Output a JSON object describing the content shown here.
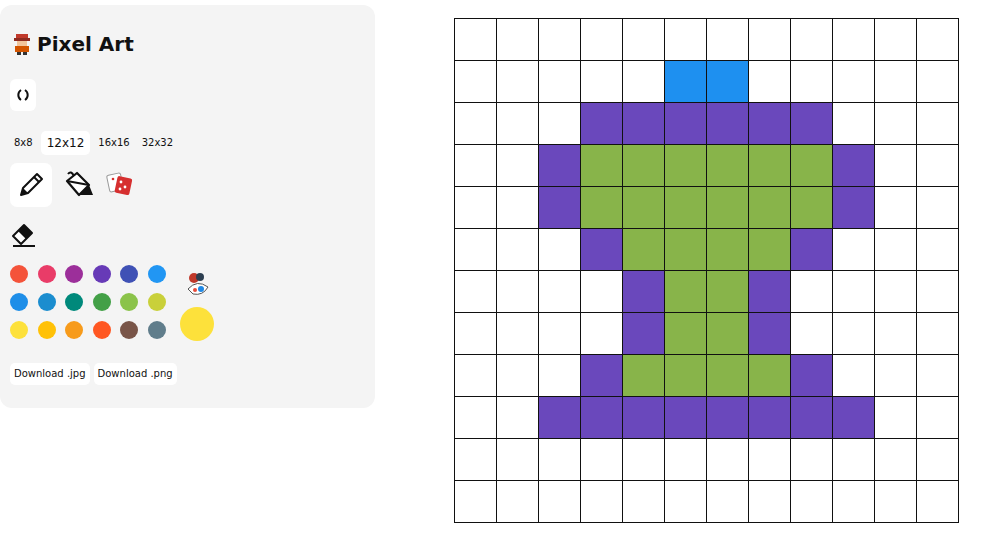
{
  "app": {
    "title": "Pixel Art"
  },
  "sizes": [
    {
      "label": "8x8",
      "selected": false
    },
    {
      "label": "12x12",
      "selected": true
    },
    {
      "label": "16x16",
      "selected": false
    },
    {
      "label": "32x32",
      "selected": false
    }
  ],
  "tools": [
    {
      "kind": "pencil",
      "selected": true
    },
    {
      "kind": "bucket",
      "selected": false
    },
    {
      "kind": "dice",
      "selected": false
    },
    {
      "kind": "eraser",
      "selected": false
    }
  ],
  "palette": [
    {
      "color": "#f4533a",
      "selected": false
    },
    {
      "color": "#e93c68",
      "selected": false
    },
    {
      "color": "#9c2f9a",
      "selected": false
    },
    {
      "color": "#673ab7",
      "selected": false
    },
    {
      "color": "#3f51b5",
      "selected": false
    },
    {
      "color": "#2196f3",
      "selected": false
    },
    {
      "color": "#1e8ee8",
      "selected": false
    },
    {
      "color": "#1b8dcf",
      "selected": false
    },
    {
      "color": "#00897b",
      "selected": false
    },
    {
      "color": "#43a047",
      "selected": false
    },
    {
      "color": "#8bc34a",
      "selected": false
    },
    {
      "color": "#c9d03a",
      "selected": false
    },
    {
      "color": "#fde13b",
      "selected": false
    },
    {
      "color": "#ffc107",
      "selected": false
    },
    {
      "color": "#f79b1b",
      "selected": false
    },
    {
      "color": "#ff5722",
      "selected": false
    },
    {
      "color": "#795548",
      "selected": false
    },
    {
      "color": "#607d8b",
      "selected": false
    }
  ],
  "current_color": {
    "color": "#fde13b"
  },
  "downloads": [
    "Download .jpg",
    "Download .png"
  ],
  "grid": {
    "rows": [
      [
        "",
        "",
        "",
        "",
        "",
        "",
        "",
        "",
        "",
        "",
        "",
        ""
      ],
      [
        "",
        "",
        "",
        "",
        "",
        "#1e90f0",
        "#1e90f0",
        "",
        "",
        "",
        "",
        ""
      ],
      [
        "",
        "",
        "",
        "#6a48bc",
        "#6a48bc",
        "#6a48bc",
        "#6a48bc",
        "#6a48bc",
        "#6a48bc",
        "",
        "",
        ""
      ],
      [
        "",
        "",
        "#6a48bc",
        "#88b44a",
        "#88b44a",
        "#88b44a",
        "#88b44a",
        "#88b44a",
        "#88b44a",
        "#6a48bc",
        "",
        ""
      ],
      [
        "",
        "",
        "#6a48bc",
        "#88b44a",
        "#88b44a",
        "#88b44a",
        "#88b44a",
        "#88b44a",
        "#88b44a",
        "#6a48bc",
        "",
        ""
      ],
      [
        "",
        "",
        "",
        "#6a48bc",
        "#88b44a",
        "#88b44a",
        "#88b44a",
        "#88b44a",
        "#6a48bc",
        "",
        "",
        ""
      ],
      [
        "",
        "",
        "",
        "",
        "#6a48bc",
        "#88b44a",
        "#88b44a",
        "#6a48bc",
        "",
        "",
        "",
        ""
      ],
      [
        "",
        "",
        "",
        "",
        "#6a48bc",
        "#88b44a",
        "#88b44a",
        "#6a48bc",
        "",
        "",
        "",
        ""
      ],
      [
        "",
        "",
        "",
        "#6a48bc",
        "#88b44a",
        "#88b44a",
        "#88b44a",
        "#88b44a",
        "#6a48bc",
        "",
        "",
        ""
      ],
      [
        "",
        "",
        "#6a48bc",
        "#6a48bc",
        "#6a48bc",
        "#6a48bc",
        "#6a48bc",
        "#6a48bc",
        "#6a48bc",
        "#6a48bc",
        "",
        ""
      ],
      [
        "",
        "",
        "",
        "",
        "",
        "",
        "",
        "",
        "",
        "",
        "",
        ""
      ],
      [
        "",
        "",
        "",
        "",
        "",
        "",
        "",
        "",
        "",
        "",
        "",
        ""
      ]
    ]
  }
}
